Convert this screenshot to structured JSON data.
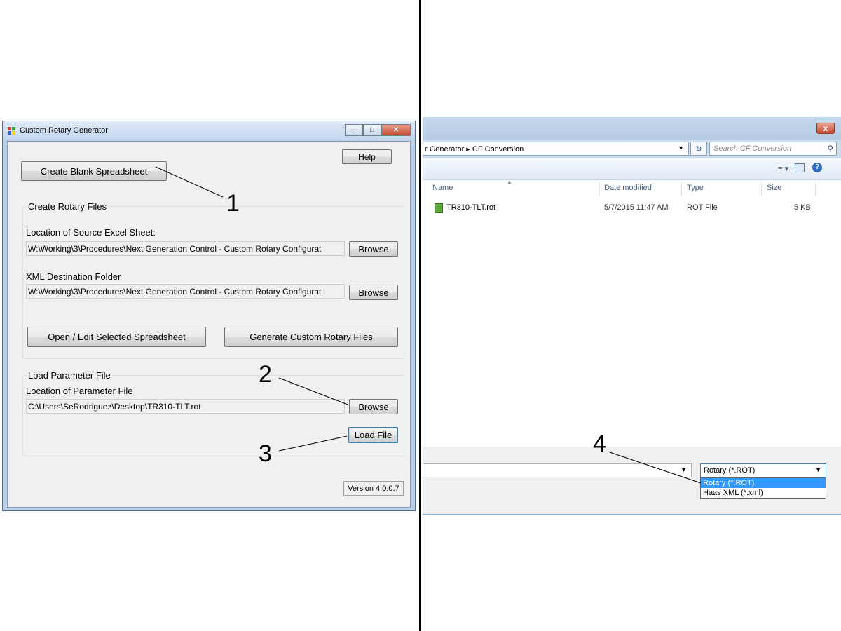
{
  "left_window": {
    "title": "Custom Rotary Generator",
    "help_label": "Help",
    "create_blank_label": "Create Blank Spreadsheet",
    "rotary_group_label": "Create Rotary Files",
    "source_label": "Location of Source Excel Sheet:",
    "source_value": "W:\\Working\\3\\Procedures\\Next Generation Control - Custom Rotary Configurat",
    "browse_label": "Browse",
    "dest_label": "XML Destination Folder",
    "dest_value": "W:\\Working\\3\\Procedures\\Next Generation Control - Custom Rotary Configurat",
    "open_edit_label": "Open / Edit Selected Spreadsheet",
    "generate_label": "Generate Custom Rotary Files",
    "param_group_label": "Load Parameter File",
    "param_location_label": "Location of Parameter File",
    "param_value": "C:\\Users\\SeRodriguez\\Desktop\\TR310-TLT.rot",
    "load_file_label": "Load File",
    "version": "Version 4.0.0.7"
  },
  "callouts": {
    "c1": "1",
    "c2": "2",
    "c3": "3",
    "c4": "4"
  },
  "right_window": {
    "close_glyph": "x",
    "breadcrumb": "r Generator  ▸  CF Conversion",
    "search_placeholder": "Search CF Conversion",
    "columns": {
      "name": "Name",
      "date": "Date modified",
      "type": "Type",
      "size": "Size"
    },
    "files": [
      {
        "name": "TR310-TLT.rot",
        "date": "5/7/2015 11:47 AM",
        "type": "ROT File",
        "size": "5 KB"
      }
    ],
    "file_type_selected": "Rotary (*.ROT)",
    "file_type_options": [
      "Rotary (*.ROT)",
      "Haas XML (*.xml)"
    ]
  },
  "colors": {
    "accent": "#3399ff",
    "close": "#c4472d",
    "frame": "#b9d1ea"
  }
}
